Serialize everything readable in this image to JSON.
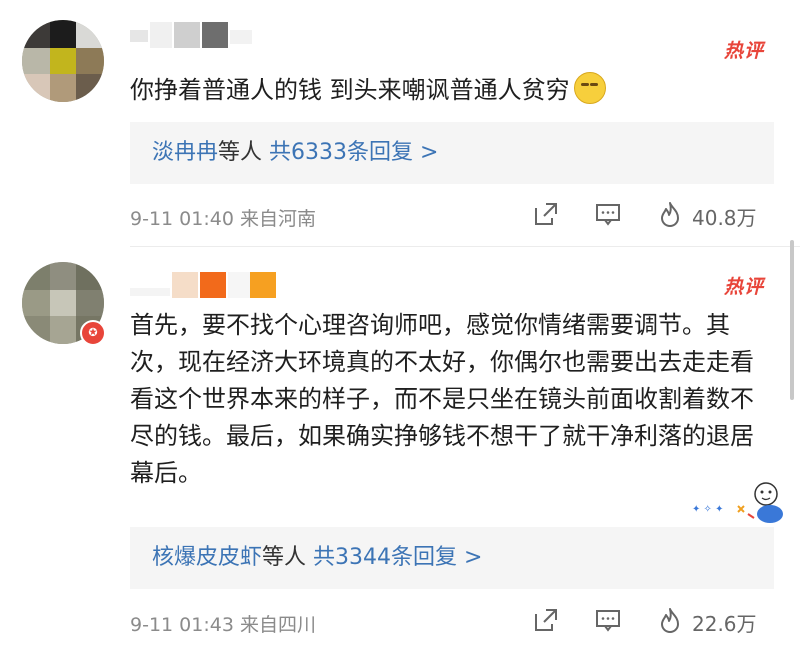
{
  "comments": [
    {
      "text": "你挣着普通人的钱 到头来嘲讽普通人贫穷",
      "emoji": "sleepy-face-emoji",
      "hot_label": "热评",
      "replies": {
        "names": "淡冉冉",
        "suffix": "等人",
        "count_text": "共6333条回复 >"
      },
      "meta": "9-11 01:40  来自河南",
      "likes": "40.8万"
    },
    {
      "text": "首先，要不找个心理咨询师吧，感觉你情绪需要调节。其次，现在经济大环境真的不太好，你偶尔也需要出去走走看看这个世界本来的样子，而不是只坐在镜头前面收割着数不尽的钱。最后，如果确实挣够钱不想干了就干净利落的退居幕后。",
      "hot_label": "热评",
      "replies": {
        "names": "核爆皮皮虾",
        "suffix": "等人",
        "count_text": "共3344条回复 >"
      },
      "meta": "9-11 01:43  来自四川",
      "likes": "22.6万"
    }
  ],
  "icons": [
    "share-icon",
    "comment-icon",
    "like-flame-icon"
  ],
  "colors": {
    "accent_red": "#e8453a",
    "link_blue": "#3c74b5",
    "meta_gray": "#8b8b8b",
    "reply_bg": "#f5f5f5"
  }
}
